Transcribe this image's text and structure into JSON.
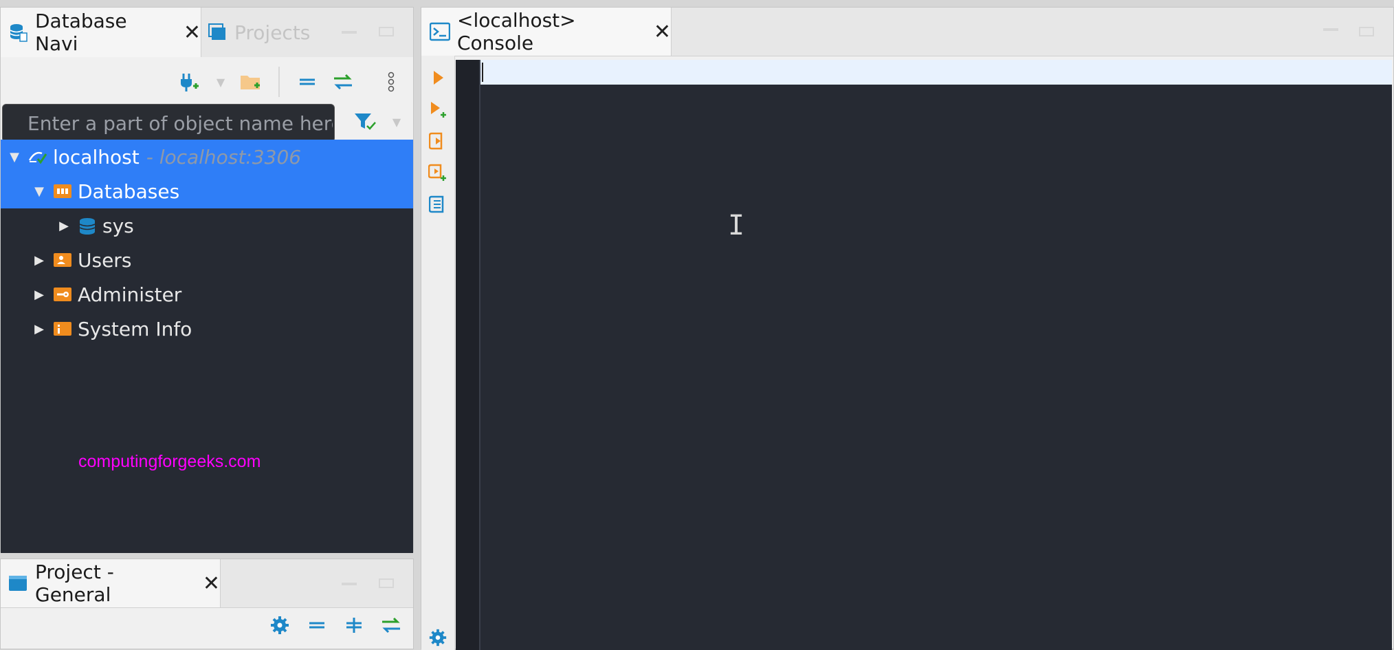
{
  "left_panel": {
    "tabs": [
      {
        "label": "Database Navi",
        "icon": "database-navigator-icon",
        "active": true
      },
      {
        "label": "Projects",
        "icon": "projects-icon",
        "active": false
      }
    ],
    "toolbar_icons": [
      "new-connection-icon",
      "new-folder-icon",
      "collapse-all-icon",
      "link-with-editor-icon",
      "view-menu-icon"
    ],
    "search": {
      "placeholder": "Enter a part of object name here",
      "value": ""
    },
    "filter_icon": "filter-config-icon",
    "tree": {
      "connection": {
        "label": "localhost",
        "hint": "- localhost:3306"
      },
      "databases": {
        "label": "Databases"
      },
      "schema": {
        "label": "sys"
      },
      "users": {
        "label": "Users"
      },
      "administer": {
        "label": "Administer"
      },
      "system_info": {
        "label": "System Info"
      }
    },
    "watermark": "computingforgeeks.com"
  },
  "project_panel": {
    "tab": {
      "label": "Project - General",
      "icon": "project-icon"
    },
    "toolbar_icons": [
      "settings-icon",
      "collapse-icon",
      "expand-icon",
      "link-icon"
    ]
  },
  "editor": {
    "tab": {
      "label": "<localhost> Console",
      "icon": "console-icon"
    },
    "side_toolbar_icons": [
      "execute-statement-icon",
      "execute-in-new-tab-icon",
      "execute-script-icon",
      "execute-script-new-tab-icon",
      "explain-plan-icon",
      "editor-settings-icon"
    ]
  },
  "colors": {
    "selection": "#2f7ef7",
    "tree_bg": "#262a33",
    "accent_orange": "#f08c1e",
    "accent_blue": "#1e88c8",
    "accent_green": "#2ca02c",
    "watermark": "#ff00ff"
  }
}
